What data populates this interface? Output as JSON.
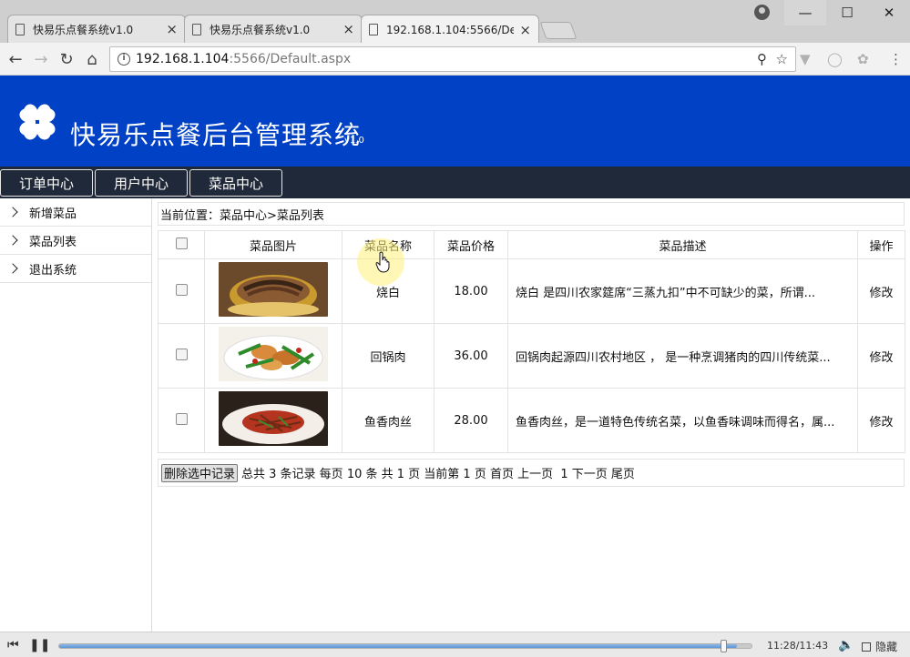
{
  "browser": {
    "tabs": [
      {
        "label": "快易乐点餐系统v1.0",
        "close": "×"
      },
      {
        "label": "快易乐点餐系统v1.0",
        "close": "×"
      },
      {
        "label": "192.168.1.104:5566/De",
        "close": "×"
      }
    ],
    "url_host": "192.168.1.104",
    "url_rest": ":5566/Default.aspx"
  },
  "site": {
    "title": "快易乐点餐后台管理系统",
    "version": "v1.0"
  },
  "menu": [
    {
      "label": "订单中心"
    },
    {
      "label": "用户中心"
    },
    {
      "label": "菜品中心"
    }
  ],
  "sidebar": [
    {
      "label": "新增菜品"
    },
    {
      "label": "菜品列表"
    },
    {
      "label": "退出系统"
    }
  ],
  "breadcrumb": "当前位置：菜品中心>菜品列表",
  "table": {
    "headers": [
      "菜品图片",
      "菜品名称",
      "菜品价格",
      "菜品描述",
      "操作"
    ],
    "rows": [
      {
        "name": "烧白",
        "price": "18.00",
        "desc": "烧白 是四川农家筵席“三蒸九扣”中不可缺少的菜，所谓...",
        "action": "修改",
        "image": "shaobai-photo"
      },
      {
        "name": "回锅肉",
        "price": "36.00",
        "desc": "回锅肉起源四川农村地区 ， 是一种烹调猪肉的四川传统菜...",
        "action": "修改",
        "image": "huiguorou-photo"
      },
      {
        "name": "鱼香肉丝",
        "price": "28.00",
        "desc": "鱼香肉丝，是一道特色传统名菜，以鱼香味调味而得名，属...",
        "action": "修改",
        "image": "yuxiangrousi-photo"
      }
    ]
  },
  "pager": {
    "delete_label": "删除选中记录",
    "summary": "总共 3 条记录 每页 10 条 共 1 页 当前第 1 页 首页 上一页  1 下一页 尾页"
  },
  "player": {
    "time": "11:28/11:43",
    "progress": 0.979,
    "hide_label": "隐藏"
  },
  "colors": {
    "banner": "#0041c6",
    "menubar": "#1f2939"
  }
}
